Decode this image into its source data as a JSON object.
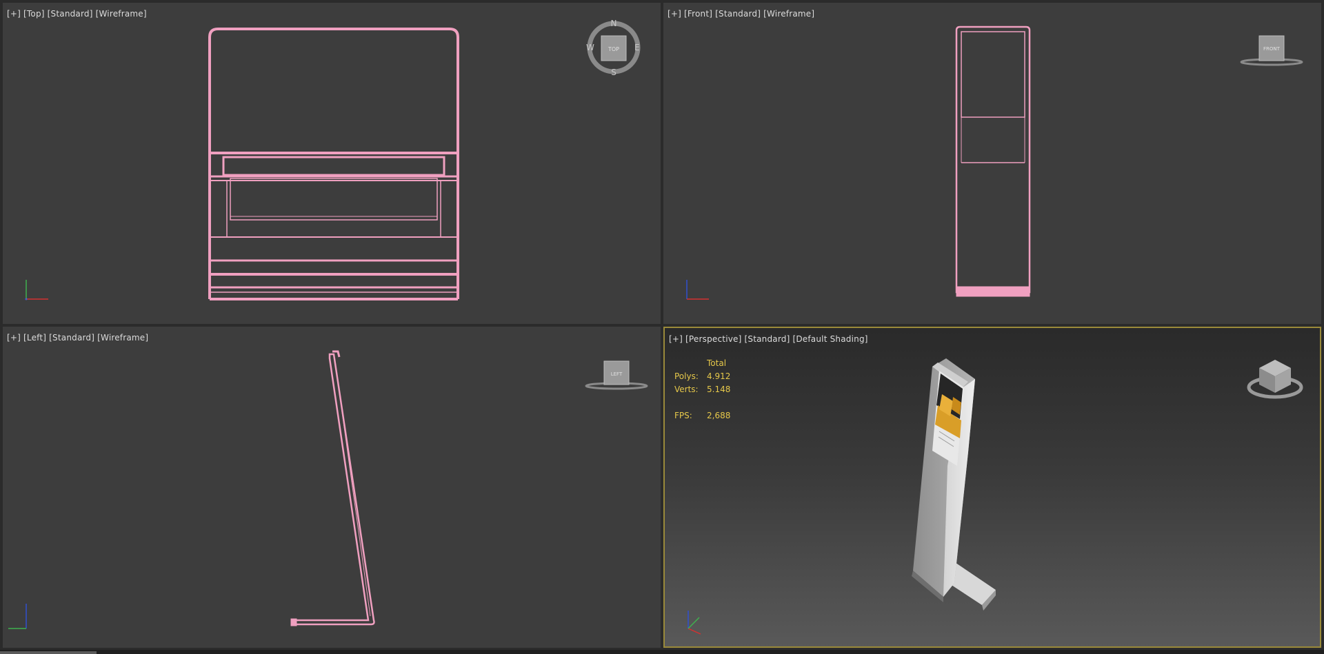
{
  "viewports": {
    "top": {
      "labels": [
        "[+]",
        "[Top]",
        "[Standard]",
        "[Wireframe]"
      ],
      "cube_label": "TOP",
      "compass": {
        "n": "N",
        "s": "S",
        "e": "E",
        "w": "W"
      },
      "axis": [
        "x",
        "y"
      ]
    },
    "front": {
      "labels": [
        "[+]",
        "[Front]",
        "[Standard]",
        "[Wireframe]"
      ],
      "cube_label": "FRONT",
      "axis": [
        "x",
        "z"
      ]
    },
    "left": {
      "labels": [
        "[+]",
        "[Left]",
        "[Standard]",
        "[Wireframe]"
      ],
      "cube_label": "LEFT",
      "axis": [
        "y",
        "z"
      ]
    },
    "perspective": {
      "labels": [
        "[+]",
        "[Perspective]",
        "[Standard]",
        "[Default Shading]"
      ],
      "stats": {
        "header": "Total",
        "polys_label": "Polys:",
        "polys": "4.912",
        "verts_label": "Verts:",
        "verts": "5.148",
        "fps_label": "FPS:",
        "fps": "2,688"
      },
      "axis": [
        "x",
        "y",
        "z"
      ]
    }
  },
  "colors": {
    "wireframe": "#f0a0c0",
    "stats": "#e6c84a",
    "active_border": "#9a8a3a"
  }
}
